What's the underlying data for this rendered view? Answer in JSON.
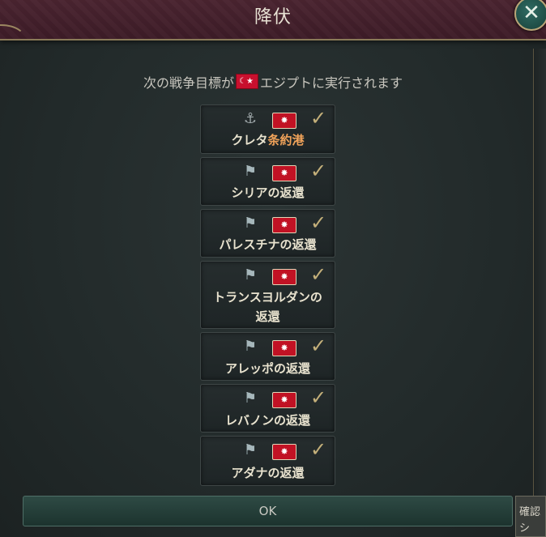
{
  "dialog": {
    "title": "降伏",
    "close_label": "✕",
    "subtitle_prefix": "次の戦争目標が",
    "subtitle_country": "エジプト",
    "subtitle_suffix": "に実行されます",
    "ok_label": "OK",
    "side_panel_text": "確認 シ"
  },
  "goals": [
    {
      "icon": "anchor-icon",
      "label_main": "クレタ",
      "label_highlight": "条約港",
      "label_line2": ""
    },
    {
      "icon": "flagpost-icon",
      "label_main": "シリアの返還",
      "label_highlight": "",
      "label_line2": ""
    },
    {
      "icon": "flagpost-icon",
      "label_main": "パレスチナの返還",
      "label_highlight": "",
      "label_line2": ""
    },
    {
      "icon": "flagpost-icon",
      "label_main": "トランスヨルダンの",
      "label_highlight": "",
      "label_line2": "返還"
    },
    {
      "icon": "flagpost-icon",
      "label_main": "アレッポの返還",
      "label_highlight": "",
      "label_line2": ""
    },
    {
      "icon": "flagpost-icon",
      "label_main": "レバノンの返還",
      "label_highlight": "",
      "label_line2": ""
    },
    {
      "icon": "flagpost-icon",
      "label_main": "アダナの返還",
      "label_highlight": "",
      "label_line2": ""
    }
  ],
  "colors": {
    "header": "#4a2430",
    "accent_gold": "#c4b07a",
    "highlight": "#f1a35a",
    "badge_red": "#c11224"
  }
}
